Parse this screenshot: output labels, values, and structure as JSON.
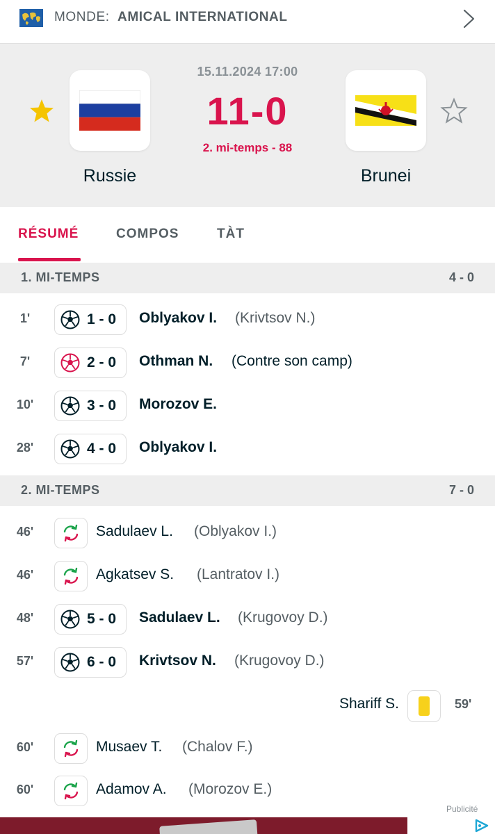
{
  "topbar": {
    "country": "MONDE:",
    "competition": "AMICAL INTERNATIONAL"
  },
  "match": {
    "datetime": "15.11.2024 17:00",
    "score": "11-0",
    "status": "2. mi-temps - 88",
    "home_team": "Russie",
    "away_team": "Brunei",
    "home_favorite": true,
    "away_favorite": false
  },
  "tabs": [
    {
      "label": "RÉSUMÉ",
      "active": true
    },
    {
      "label": "COMPOS",
      "active": false
    },
    {
      "label": "TÀT",
      "active": false
    }
  ],
  "periods": [
    {
      "label": "1. MI-TEMPS",
      "score": "4 - 0"
    },
    {
      "label": "2. MI-TEMPS",
      "score": "7 - 0"
    }
  ],
  "incidents": [
    {
      "minute": "1'",
      "type": "goal",
      "score": "1 - 0",
      "player": "Oblyakov I.",
      "assist": "(Krivtsov N.)"
    },
    {
      "minute": "7'",
      "type": "own-goal",
      "score": "2 - 0",
      "player": "Othman N.",
      "assist": "(Contre son camp)"
    },
    {
      "minute": "10'",
      "type": "goal",
      "score": "3 - 0",
      "player": "Morozov E.",
      "assist": ""
    },
    {
      "minute": "28'",
      "type": "goal",
      "score": "4 - 0",
      "player": "Oblyakov I.",
      "assist": ""
    },
    {
      "minute": "46'",
      "type": "substitution",
      "player": "Sadulaev L.",
      "assist": "(Oblyakov I.)"
    },
    {
      "minute": "46'",
      "type": "substitution",
      "player": "Agkatsev S.",
      "assist": "(Lantratov I.)"
    },
    {
      "minute": "48'",
      "type": "goal",
      "score": "5 - 0",
      "player": "Sadulaev L.",
      "assist": "(Krugovoy D.)"
    },
    {
      "minute": "57'",
      "type": "goal",
      "score": "6 - 0",
      "player": "Krivtsov N.",
      "assist": "(Krugovoy D.)"
    },
    {
      "minute": "59'",
      "type": "yellow-card",
      "player": "Shariff S.",
      "side": "away"
    },
    {
      "minute": "60'",
      "type": "substitution",
      "player": "Musaev T.",
      "assist": "(Chalov F.)"
    },
    {
      "minute": "60'",
      "type": "substitution",
      "player": "Adamov A.",
      "assist": "(Morozov E.)"
    }
  ],
  "ad": {
    "label": "Publicité"
  },
  "colors": {
    "accent": "#d9144d",
    "star_active": "#f5c400",
    "yellow_card": "#f7d11b",
    "sub_in": "#1aa34a",
    "sub_out": "#d9144d"
  }
}
